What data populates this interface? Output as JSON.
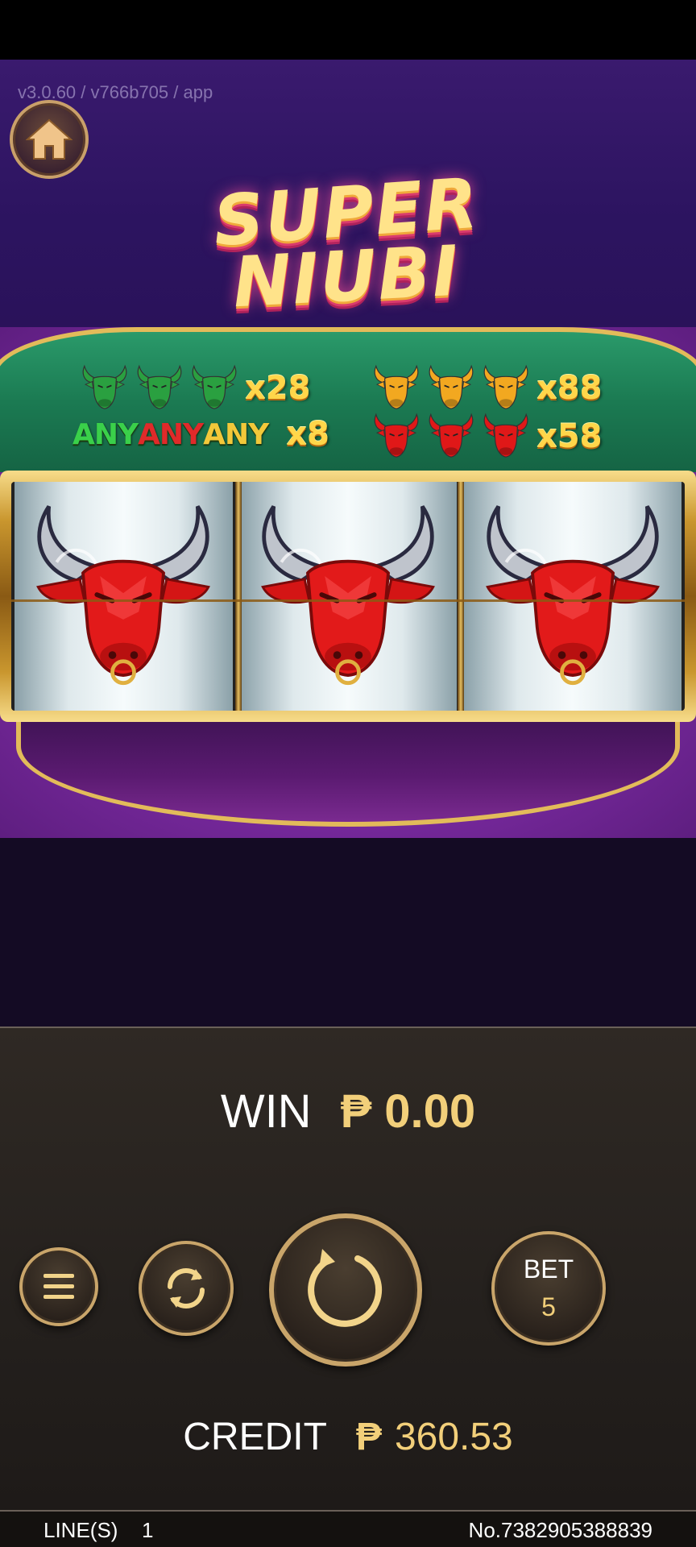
{
  "header": {
    "version": "v3.0.60 / v766b705 / app",
    "logo_line1": "SUPER",
    "logo_line2": "NIUBI"
  },
  "paytable": {
    "green_mult": "x28",
    "gold_mult": "x88",
    "any_words": [
      "ANY",
      "ANY",
      "ANY"
    ],
    "any_mult": "x8",
    "red_mult": "x58"
  },
  "reels": {
    "symbols": [
      "red-bull",
      "red-bull",
      "red-bull"
    ]
  },
  "panel": {
    "win_label": "WIN",
    "currency": "₱",
    "win_value": "0.00",
    "bet_label": "BET",
    "bet_value": "5",
    "credit_label": "CREDIT",
    "credit_value": "360.53"
  },
  "footer": {
    "lines_label": "LINE(S)",
    "lines_value": "1",
    "ticket_no": "No.7382905388839"
  },
  "colors": {
    "gold": "#f2cf7a",
    "header_purple": "#2c1460",
    "table_green": "#1b7a52",
    "bull_red": "#e01818",
    "bull_green": "#2aa040",
    "bull_gold": "#f2a820"
  }
}
